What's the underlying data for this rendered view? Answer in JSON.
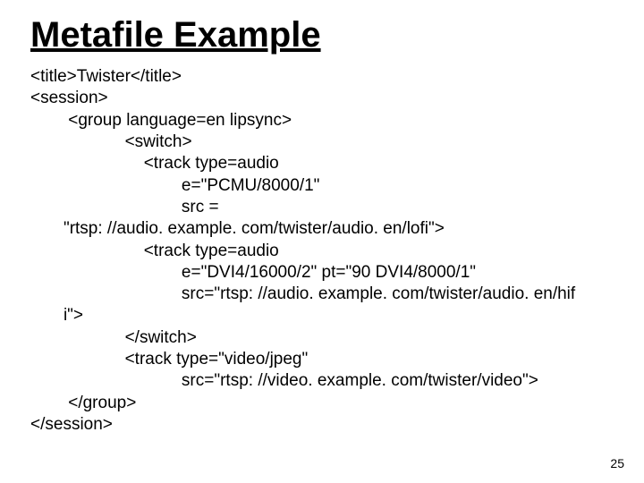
{
  "title": "Metafile Example",
  "code_lines": [
    "<title>Twister</title>",
    "<session>",
    "        <group language=en lipsync>",
    "                    <switch>",
    "                        <track type=audio",
    "                                e=\"PCMU/8000/1\"",
    "                                src =",
    "       \"rtsp: //audio. example. com/twister/audio. en/lofi\">",
    "                        <track type=audio",
    "                                e=\"DVI4/16000/2\" pt=\"90 DVI4/8000/1\"",
    "                                src=\"rtsp: //audio. example. com/twister/audio. en/hif",
    "       i\">",
    "                    </switch>",
    "                    <track type=\"video/jpeg\"",
    "                                src=\"rtsp: //video. example. com/twister/video\">",
    "        </group>",
    "</session>"
  ],
  "page_number": "25"
}
